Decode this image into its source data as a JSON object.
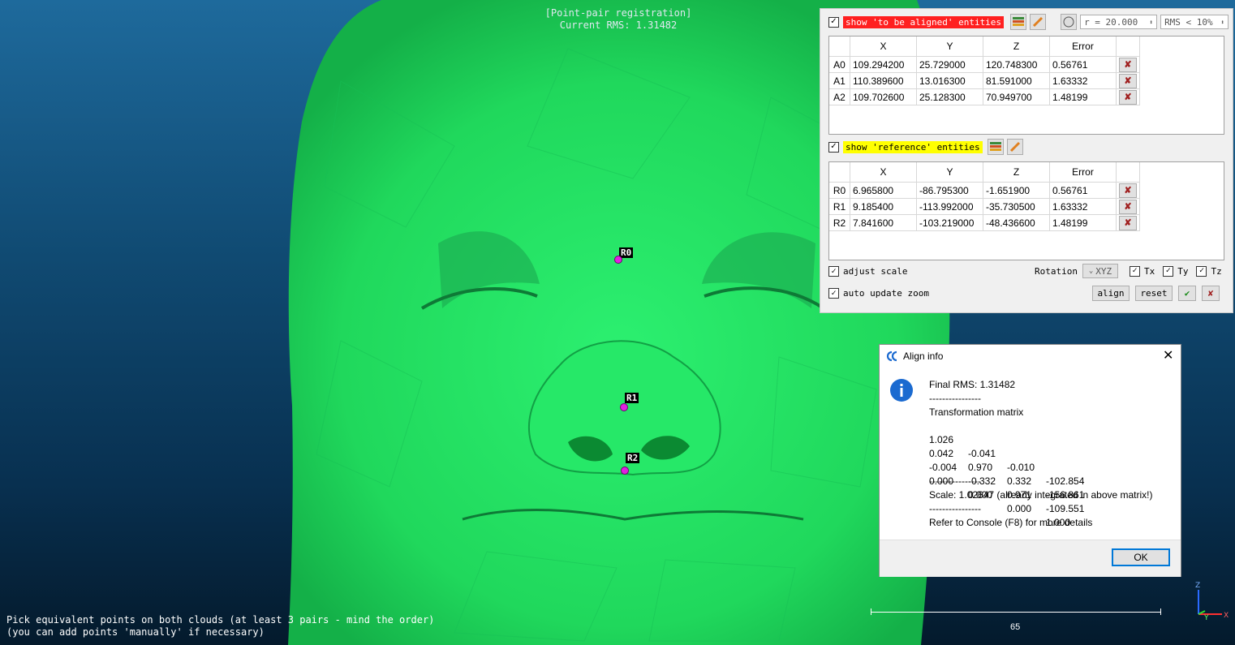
{
  "viewport": {
    "title_line1": "[Point-pair registration]",
    "title_line2": "Current RMS: 1.31482",
    "bottom_line1": "Pick equivalent points on both clouds (at least 3 pairs - mind the order)",
    "bottom_line2": "(you can add points 'manually' if necessary)",
    "points": [
      "R0",
      "R1",
      "R2"
    ],
    "scale_value": "65",
    "axis_labels": {
      "z": "Z",
      "x": "X",
      "y": "Y"
    },
    "colors": {
      "mesh": "#22e060",
      "point": "#e020e0"
    }
  },
  "panel": {
    "aligned": {
      "checkbox_label": "show 'to be aligned' entities",
      "radius": "r = 20.000",
      "rms_filter": "RMS < 10%",
      "headers": [
        "X",
        "Y",
        "Z",
        "Error"
      ],
      "rows": [
        {
          "id": "A0",
          "x": "109.294200",
          "y": "25.729000",
          "z": "120.748300",
          "err": "0.56761"
        },
        {
          "id": "A1",
          "x": "110.389600",
          "y": "13.016300",
          "z": "81.591000",
          "err": "1.63332"
        },
        {
          "id": "A2",
          "x": "109.702600",
          "y": "25.128300",
          "z": "70.949700",
          "err": "1.48199"
        }
      ]
    },
    "reference": {
      "checkbox_label": "show 'reference' entities",
      "headers": [
        "X",
        "Y",
        "Z",
        "Error"
      ],
      "rows": [
        {
          "id": "R0",
          "x": "6.965800",
          "y": "-86.795300",
          "z": "-1.651900",
          "err": "0.56761"
        },
        {
          "id": "R1",
          "x": "9.185400",
          "y": "-113.992000",
          "z": "-35.730500",
          "err": "1.63332"
        },
        {
          "id": "R2",
          "x": "7.841600",
          "y": "-103.219000",
          "z": "-48.436600",
          "err": "1.48199"
        }
      ]
    },
    "delete_glyph": "✘",
    "adjust_scale": "adjust scale",
    "rotation_label": "Rotation",
    "rotation_value": "XYZ",
    "tx": "Tx",
    "ty": "Ty",
    "tz": "Tz",
    "auto_update_zoom": "auto update zoom",
    "align_label": "align",
    "reset_label": "reset",
    "ok_glyph": "✔",
    "cancel_glyph": "✘"
  },
  "dialog": {
    "title": "Align info",
    "final_rms": "Final RMS: 1.31482",
    "separator": "----------------",
    "matrix_title": "Transformation matrix",
    "matrix": [
      [
        "1.026",
        "-0.041",
        "-0.010",
        "-102.854"
      ],
      [
        "0.042",
        "0.970",
        "0.332",
        "-156.861"
      ],
      [
        "-0.004",
        "-0.332",
        "0.971",
        "-109.551"
      ],
      [
        "0.000",
        "0.000",
        "0.000",
        "1.000"
      ]
    ],
    "scale": "Scale: 1.02647 (already integrated in above matrix!)",
    "refer": "Refer to Console (F8) for more details",
    "ok_label": "OK"
  }
}
